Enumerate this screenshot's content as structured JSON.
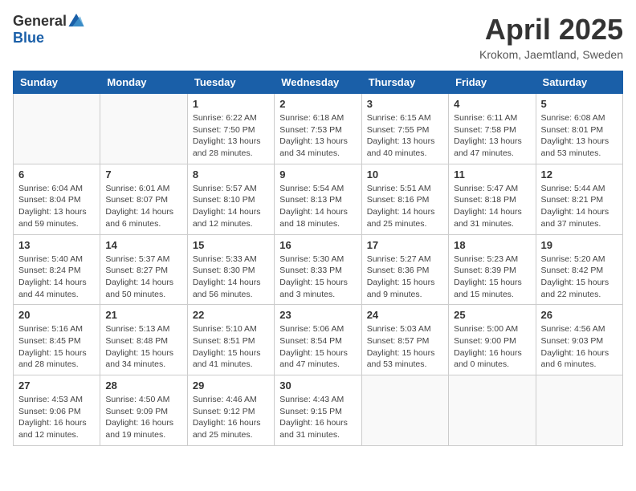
{
  "header": {
    "logo_general": "General",
    "logo_blue": "Blue",
    "title": "April 2025",
    "location": "Krokom, Jaemtland, Sweden"
  },
  "weekdays": [
    "Sunday",
    "Monday",
    "Tuesday",
    "Wednesday",
    "Thursday",
    "Friday",
    "Saturday"
  ],
  "weeks": [
    [
      {
        "day": "",
        "empty": true
      },
      {
        "day": "",
        "empty": true
      },
      {
        "day": "1",
        "sunrise": "6:22 AM",
        "sunset": "7:50 PM",
        "daylight": "13 hours and 28 minutes."
      },
      {
        "day": "2",
        "sunrise": "6:18 AM",
        "sunset": "7:53 PM",
        "daylight": "13 hours and 34 minutes."
      },
      {
        "day": "3",
        "sunrise": "6:15 AM",
        "sunset": "7:55 PM",
        "daylight": "13 hours and 40 minutes."
      },
      {
        "day": "4",
        "sunrise": "6:11 AM",
        "sunset": "7:58 PM",
        "daylight": "13 hours and 47 minutes."
      },
      {
        "day": "5",
        "sunrise": "6:08 AM",
        "sunset": "8:01 PM",
        "daylight": "13 hours and 53 minutes."
      }
    ],
    [
      {
        "day": "6",
        "sunrise": "6:04 AM",
        "sunset": "8:04 PM",
        "daylight": "13 hours and 59 minutes."
      },
      {
        "day": "7",
        "sunrise": "6:01 AM",
        "sunset": "8:07 PM",
        "daylight": "14 hours and 6 minutes."
      },
      {
        "day": "8",
        "sunrise": "5:57 AM",
        "sunset": "8:10 PM",
        "daylight": "14 hours and 12 minutes."
      },
      {
        "day": "9",
        "sunrise": "5:54 AM",
        "sunset": "8:13 PM",
        "daylight": "14 hours and 18 minutes."
      },
      {
        "day": "10",
        "sunrise": "5:51 AM",
        "sunset": "8:16 PM",
        "daylight": "14 hours and 25 minutes."
      },
      {
        "day": "11",
        "sunrise": "5:47 AM",
        "sunset": "8:18 PM",
        "daylight": "14 hours and 31 minutes."
      },
      {
        "day": "12",
        "sunrise": "5:44 AM",
        "sunset": "8:21 PM",
        "daylight": "14 hours and 37 minutes."
      }
    ],
    [
      {
        "day": "13",
        "sunrise": "5:40 AM",
        "sunset": "8:24 PM",
        "daylight": "14 hours and 44 minutes."
      },
      {
        "day": "14",
        "sunrise": "5:37 AM",
        "sunset": "8:27 PM",
        "daylight": "14 hours and 50 minutes."
      },
      {
        "day": "15",
        "sunrise": "5:33 AM",
        "sunset": "8:30 PM",
        "daylight": "14 hours and 56 minutes."
      },
      {
        "day": "16",
        "sunrise": "5:30 AM",
        "sunset": "8:33 PM",
        "daylight": "15 hours and 3 minutes."
      },
      {
        "day": "17",
        "sunrise": "5:27 AM",
        "sunset": "8:36 PM",
        "daylight": "15 hours and 9 minutes."
      },
      {
        "day": "18",
        "sunrise": "5:23 AM",
        "sunset": "8:39 PM",
        "daylight": "15 hours and 15 minutes."
      },
      {
        "day": "19",
        "sunrise": "5:20 AM",
        "sunset": "8:42 PM",
        "daylight": "15 hours and 22 minutes."
      }
    ],
    [
      {
        "day": "20",
        "sunrise": "5:16 AM",
        "sunset": "8:45 PM",
        "daylight": "15 hours and 28 minutes."
      },
      {
        "day": "21",
        "sunrise": "5:13 AM",
        "sunset": "8:48 PM",
        "daylight": "15 hours and 34 minutes."
      },
      {
        "day": "22",
        "sunrise": "5:10 AM",
        "sunset": "8:51 PM",
        "daylight": "15 hours and 41 minutes."
      },
      {
        "day": "23",
        "sunrise": "5:06 AM",
        "sunset": "8:54 PM",
        "daylight": "15 hours and 47 minutes."
      },
      {
        "day": "24",
        "sunrise": "5:03 AM",
        "sunset": "8:57 PM",
        "daylight": "15 hours and 53 minutes."
      },
      {
        "day": "25",
        "sunrise": "5:00 AM",
        "sunset": "9:00 PM",
        "daylight": "16 hours and 0 minutes."
      },
      {
        "day": "26",
        "sunrise": "4:56 AM",
        "sunset": "9:03 PM",
        "daylight": "16 hours and 6 minutes."
      }
    ],
    [
      {
        "day": "27",
        "sunrise": "4:53 AM",
        "sunset": "9:06 PM",
        "daylight": "16 hours and 12 minutes."
      },
      {
        "day": "28",
        "sunrise": "4:50 AM",
        "sunset": "9:09 PM",
        "daylight": "16 hours and 19 minutes."
      },
      {
        "day": "29",
        "sunrise": "4:46 AM",
        "sunset": "9:12 PM",
        "daylight": "16 hours and 25 minutes."
      },
      {
        "day": "30",
        "sunrise": "4:43 AM",
        "sunset": "9:15 PM",
        "daylight": "16 hours and 31 minutes."
      },
      {
        "day": "",
        "empty": true
      },
      {
        "day": "",
        "empty": true
      },
      {
        "day": "",
        "empty": true
      }
    ]
  ]
}
